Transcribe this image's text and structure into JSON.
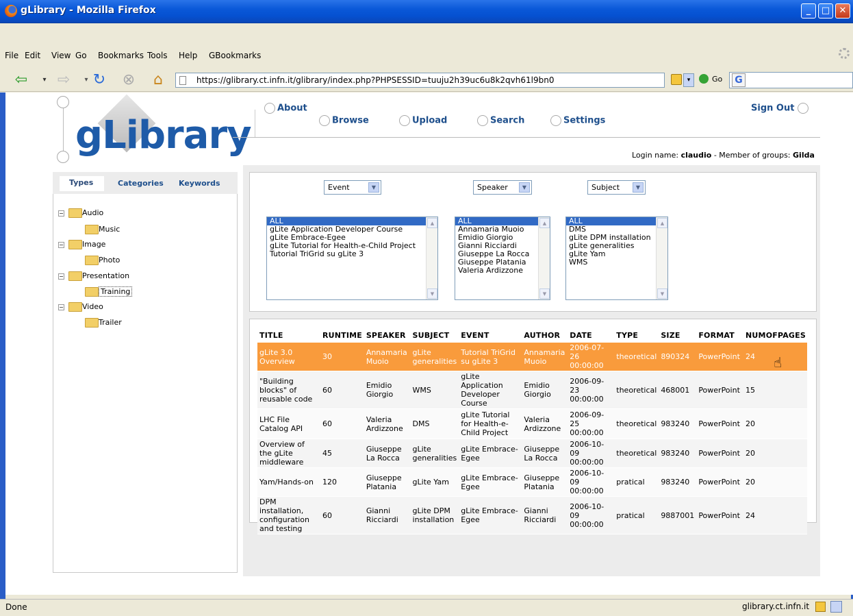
{
  "window": {
    "title": "gLibrary - Mozilla Firefox"
  },
  "menu": [
    "File",
    "Edit",
    "View",
    "Go",
    "Bookmarks",
    "Tools",
    "Help",
    "GBookmarks"
  ],
  "toolbar": {
    "url": "https://glibrary.ct.infn.it/glibrary/index.php?PHPSESSID=tuuju2h39uc6u8k2qvh61l9bn0",
    "go_label": "Go",
    "search_value": ""
  },
  "site": {
    "logo_text": "gLibrary",
    "nav": {
      "about": "About",
      "browse": "Browse",
      "upload": "Upload",
      "search": "Search",
      "settings": "Settings",
      "sign_out": "Sign Out"
    },
    "login": {
      "prefix": "Login name: ",
      "user": "claudio",
      "middle": " - Member of groups: ",
      "group": "Gilda"
    }
  },
  "left_panel": {
    "tabs": [
      "Types",
      "Categories",
      "Keywords"
    ],
    "tree": {
      "audio": "Audio",
      "music": "Music",
      "image": "Image",
      "photo": "Photo",
      "presentation": "Presentation",
      "training": "Training",
      "video": "Video",
      "trailer": "Trailer"
    }
  },
  "filters": {
    "event": {
      "label": "Event",
      "options": [
        "ALL",
        "gLite Application Developer Course",
        "gLite Embrace-Egee",
        "gLite Tutorial for Health-e-Child Project",
        "Tutorial TriGrid su gLite 3"
      ]
    },
    "speaker": {
      "label": "Speaker",
      "options": [
        "ALL",
        "Annamaria Muoio",
        "Emidio Giorgio",
        "Gianni Ricciardi",
        "Giuseppe La Rocca",
        "Giuseppe Platania",
        "Valeria Ardizzone"
      ]
    },
    "subject": {
      "label": "Subject",
      "options": [
        "ALL",
        "DMS",
        "gLite DPM installation",
        "gLite generalities",
        "gLite Yam",
        "WMS"
      ]
    }
  },
  "table": {
    "headers": [
      "TITLE",
      "RUNTIME",
      "SPEAKER",
      "SUBJECT",
      "EVENT",
      "AUTHOR",
      "DATE",
      "TYPE",
      "SIZE",
      "FORMAT",
      "NUMOFPAGES"
    ],
    "rows": [
      [
        "gLite 3.0 Overview",
        "30",
        "Annamaria Muoio",
        "gLite generalities",
        "Tutorial TriGrid su gLite 3",
        "Annamaria Muoio",
        "2006-07-26 00:00:00",
        "theoretical",
        "890324",
        "PowerPoint",
        "24"
      ],
      [
        "\"Building blocks\" of reusable code",
        "60",
        "Emidio Giorgio",
        "WMS",
        "gLite Application Developer Course",
        "Emidio Giorgio",
        "2006-09-23 00:00:00",
        "theoretical",
        "468001",
        "PowerPoint",
        "15"
      ],
      [
        "LHC File Catalog API",
        "60",
        "Valeria Ardizzone",
        "DMS",
        "gLite Tutorial for Health-e-Child Project",
        "Valeria Ardizzone",
        "2006-09-25 00:00:00",
        "theoretical",
        "983240",
        "PowerPoint",
        "20"
      ],
      [
        "Overview of the gLite middleware",
        "45",
        "Giuseppe La Rocca",
        "gLite generalities",
        "gLite Embrace-Egee",
        "Giuseppe La Rocca",
        "2006-10-09 00:00:00",
        "theoretical",
        "983240",
        "PowerPoint",
        "20"
      ],
      [
        "Yam/Hands-on",
        "120",
        "Giuseppe Platania",
        "gLite Yam",
        "gLite Embrace-Egee",
        "Giuseppe Platania",
        "2006-10-09 00:00:00",
        "pratical",
        "983240",
        "PowerPoint",
        "20"
      ],
      [
        "DPM installation, configuration and testing",
        "60",
        "Gianni Ricciardi",
        "gLite DPM installation",
        "gLite Embrace-Egee",
        "Gianni Ricciardi",
        "2006-10-09 00:00:00",
        "pratical",
        "9887001",
        "PowerPoint",
        "24"
      ]
    ]
  },
  "status": {
    "text": "Done",
    "host": "glibrary.ct.infn.it"
  }
}
